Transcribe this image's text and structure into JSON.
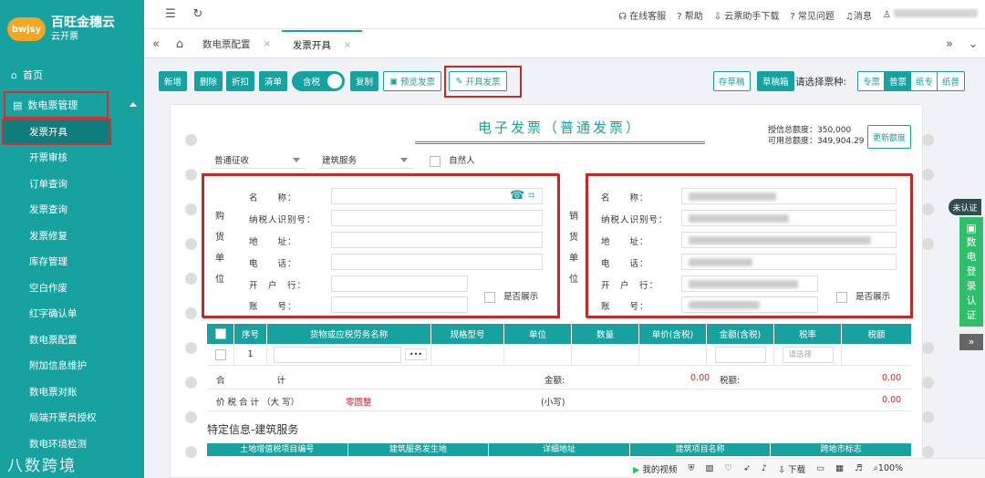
{
  "app": {
    "logo_badge": "bwjsy",
    "title": "百旺金穗云",
    "subtitle": "云开票"
  },
  "sidebar": {
    "home": "首页",
    "group": "数电票管理",
    "items": [
      "发票开具",
      "开票审核",
      "订单查询",
      "发票查询",
      "发票修复",
      "库存管理",
      "空白作废",
      "红字确认单",
      "数电票配置",
      "附加信息维护",
      "数电票对账",
      "局端开票员授权",
      "数电环境检测"
    ]
  },
  "topbar": {
    "service": "在线客服",
    "help": "帮助",
    "download": "云票助手下载",
    "faq": "常见问题",
    "message": "消息"
  },
  "tabs": [
    "数电票配置",
    "发票开具"
  ],
  "toolbar": {
    "add": "新增",
    "delete": "删除",
    "discount": "折扣",
    "clear": "清单",
    "tax_toggle": "含税",
    "copy": "复制",
    "preview": "预览发票",
    "issue": "开具发票",
    "save_draft": "存草稿",
    "draft_box": "草稿箱",
    "type_prompt": "请选择票种:",
    "types": [
      "专票",
      "普票",
      "纸专",
      "纸普"
    ]
  },
  "invoice": {
    "title": "电子发票（普通发票）",
    "quota_total": "授信总额度：350,000",
    "quota_available": "可用总额度：349,904.29",
    "update_quota": "更新额度",
    "levy_type": "普通征收",
    "special_business": "建筑服务",
    "natural_person": "自然人",
    "buyer_label": [
      "购",
      "货",
      "单",
      "位"
    ],
    "seller_label": [
      "销",
      "货",
      "单",
      "位"
    ],
    "buyer_fields": [
      "名　　称：",
      "纳税人识别号：",
      "地　　址：",
      "电　　话：",
      "开　户　行：",
      "账　　号："
    ],
    "seller_fields": [
      "名　　称：",
      "纳税人识别号：",
      "地　　址：",
      "电　　话：",
      "开　户　行：",
      "账　　号："
    ],
    "show_buyer": "是否展示",
    "show_seller": "是否展示"
  },
  "table": {
    "headers": [
      "序号",
      "货物或应税劳务名称",
      "规格型号",
      "单位",
      "数量",
      "单价(含税)",
      "金额(含税)",
      "税率",
      "税额"
    ],
    "row_index": "1",
    "more": "•••",
    "rate_placeholder": "请选择",
    "total_label": "合　　　　　　计",
    "amount_label": "金额:",
    "amount_value": "0.00",
    "tax_label": "税额:",
    "tax_value": "0.00",
    "cn_total_label": "价 税 合 计 （大 写）",
    "cn_total_value": "零圆整",
    "small_label": "(小写)",
    "small_value": "0.00"
  },
  "special": {
    "title": "特定信息-建筑服务",
    "headers": [
      "土地增值税项目编号",
      "建筑服务发生地",
      "详细地址",
      "建筑项目名称",
      "跨地市标志"
    ]
  },
  "rightbar": {
    "status": "未认证",
    "label": [
      "数",
      "电",
      "登",
      "录",
      "认",
      "证"
    ]
  },
  "watermark": "八数跨境",
  "status": {
    "video": "我的视频",
    "download": "下载",
    "zoom": "100%"
  }
}
